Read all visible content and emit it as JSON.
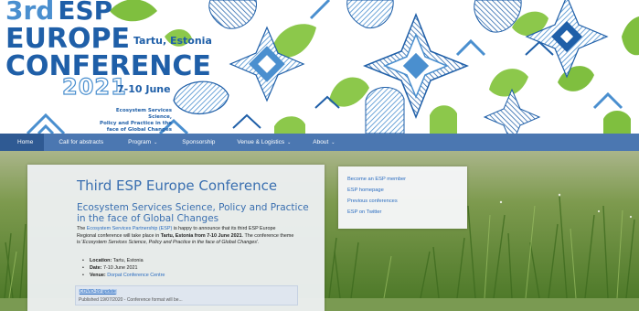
{
  "banner": {
    "ordinal": "3rd",
    "acronym": "ESP",
    "word_europe": "EUROPE",
    "location": "Tartu, Estonia",
    "word_conference": "CONFERENCE",
    "year": "2021",
    "dates": "7-10 June",
    "tagline": [
      "Ecosystem Services Science,",
      "Policy and Practice in the",
      "face of Global Changes"
    ],
    "colors": {
      "primary": "#1f5fa8",
      "light_blue": "#4a8fcf",
      "leaf_green": "#7fbf3f"
    }
  },
  "nav": {
    "items": [
      {
        "label": "Home",
        "active": true
      },
      {
        "label": "Call for abstracts"
      },
      {
        "label": "Program",
        "caret": "⌄"
      },
      {
        "label": "Sponsorship"
      },
      {
        "label": "Venue & Logistics",
        "caret": "⌄"
      },
      {
        "label": "About",
        "caret": "⌄"
      }
    ],
    "colors": {
      "bar": "#4b77b1",
      "active": "#2f5a93"
    }
  },
  "main": {
    "title": "Third ESP Europe Conference",
    "subtitle": "Ecosystem Services Science, Policy and Practice in the face of Global Changes",
    "intro": {
      "part1": "The ",
      "link": "Ecosystem Services Partnership (ESP)",
      "part2": " is happy to announce that its third ESP Europe Regional conference will take place in ",
      "bold": "Tartu, Estonia from 7-10 June 2021",
      "part3": ". The conference theme is '",
      "theme": "Ecosystem Services Science, Policy and Practice in the face of Global Changes",
      "part4": "'."
    },
    "details": [
      {
        "label": "Location:",
        "value": "Tartu, Estonia"
      },
      {
        "label": "Date:",
        "value": "7-10 June 2021"
      },
      {
        "label": "Venue:",
        "value": "Dorpat Conference Centre"
      }
    ],
    "covid": {
      "title": "COVID-19 update",
      "text": "Published 19/07/2020 - Conference format will be..."
    }
  },
  "sidebar": {
    "links": [
      "Become an ESP member",
      "ESP homepage",
      "Previous conferences",
      "ESP on Twitter"
    ]
  }
}
